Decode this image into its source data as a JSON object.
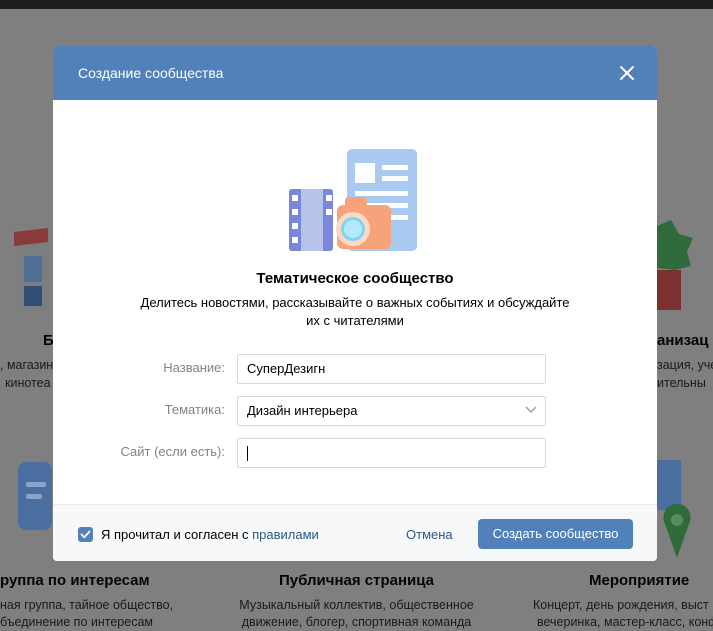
{
  "modal": {
    "title": "Создание сообщества",
    "heading": "Тематическое сообщество",
    "subtext_line1": "Делитесь новостями, рассказывайте о важных событиях и обсуждайте",
    "subtext_line2": "их с читателями",
    "form": {
      "name_label": "Название:",
      "name_value": "СуперДезигн",
      "topic_label": "Тематика:",
      "topic_value": "Дизайн интерьера",
      "site_label": "Сайт (если есть):",
      "site_value": ""
    },
    "footer": {
      "agree_text": "Я прочитал и согласен с ",
      "rules_link": "правилами",
      "cancel_label": "Отмена",
      "create_label": "Создать сообщество",
      "agree_checked": true
    }
  },
  "background": {
    "left_top": {
      "title": "Б",
      "desc1": "",
      "desc2": ", магазин",
      "desc3": "кинотеа"
    },
    "right_top": {
      "title": "анизац",
      "desc1": "зация, уче",
      "desc2": "ительны"
    },
    "cards": [
      {
        "title": "руппа по интересам",
        "desc1": "ная группа, тайное общество,",
        "desc2": "бъединение по интересам"
      },
      {
        "title": "Публичная страница",
        "desc1": "Музыкальный коллектив, общественное",
        "desc2": "движение, блогер, спортивная команда"
      },
      {
        "title": "Мероприятие",
        "desc1": "Концерт, день рождения, выст",
        "desc2": "вечеринка, мастер-класс, конф"
      }
    ]
  },
  "colors": {
    "accent": "#5181b8",
    "link": "#2a5885",
    "overlay": "#7f7f80"
  }
}
